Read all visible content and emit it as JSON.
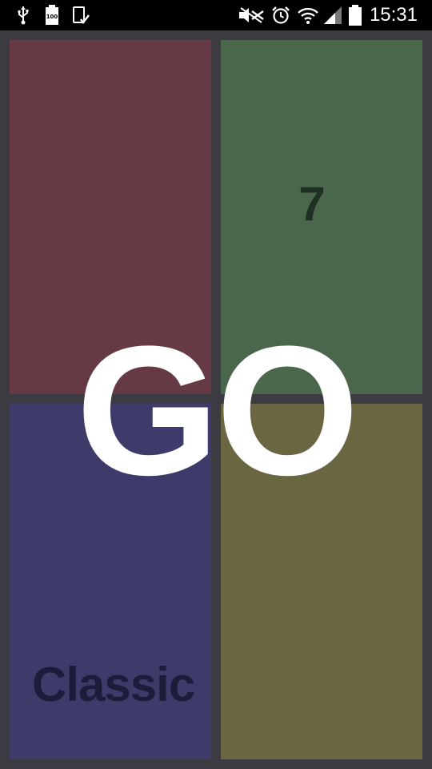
{
  "status_bar": {
    "time": "15:31",
    "battery_level": "100",
    "icons": [
      "usb-icon",
      "battery-full-icon",
      "screenshot-icon",
      "nfc-mute-icon",
      "alarm-icon",
      "wifi-icon",
      "signal-icon",
      "battery-icon"
    ]
  },
  "game": {
    "go_label": "GO",
    "counter": "7",
    "mode": "Classic",
    "tiles": {
      "red": "#663a44",
      "green": "#4a664b",
      "blue": "#3e3a69",
      "yellow": "#696641"
    },
    "background": "#3b3b41"
  }
}
